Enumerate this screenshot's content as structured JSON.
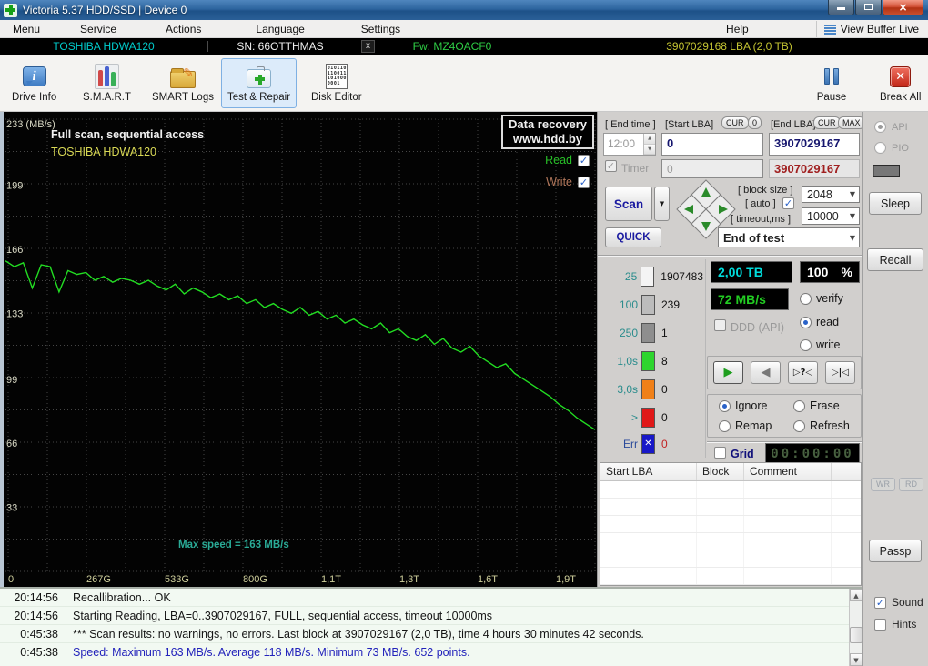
{
  "window": {
    "title": "Victoria 5.37 HDD/SSD | Device 0"
  },
  "menu": {
    "items": [
      "Menu",
      "Service",
      "Actions",
      "Language",
      "Settings"
    ],
    "help": "Help",
    "view_buffer": "View Buffer Live"
  },
  "infobar": {
    "model": "TOSHIBA HDWA120",
    "serial": "SN: 66OTTHMAS",
    "close_label": "x",
    "firmware": "Fw: MZ4OACF0",
    "capacity": "3907029168 LBA (2,0 TB)"
  },
  "toolbar": {
    "buttons": [
      "Drive Info",
      "S.M.A.R.T",
      "SMART Logs",
      "Test & Repair",
      "Disk Editor"
    ],
    "active_button": "Test & Repair",
    "pause": "Pause",
    "break_all": "Break All"
  },
  "chart_data": {
    "type": "line",
    "title": "Full scan, sequential access",
    "subtitle": "TOSHIBA HDWA120",
    "ylabel_unit": "(MB/s)",
    "ymax": 233,
    "yticks": [
      233,
      199,
      166,
      133,
      99,
      66,
      33
    ],
    "xticks": [
      "0",
      "267G",
      "533G",
      "800G",
      "1,1T",
      "1,3T",
      "1,6T",
      "1,9T"
    ],
    "grid": true,
    "legend_position": "top-right",
    "series": [
      {
        "name": "Read",
        "color": "#22dd22",
        "x_mode": "uniform fractions of full LBA span 0..3907029167",
        "speed_mbs": [
          160,
          157,
          159,
          146,
          158,
          157,
          144,
          155,
          153,
          154,
          150,
          152,
          149,
          151,
          150,
          148,
          150,
          147,
          145,
          148,
          143,
          146,
          144,
          141,
          143,
          140,
          142,
          138,
          140,
          136,
          138,
          135,
          133,
          136,
          132,
          134,
          130,
          132,
          128,
          130,
          127,
          125,
          128,
          123,
          125,
          121,
          119,
          122,
          117,
          120,
          115,
          113,
          116,
          111,
          108,
          105,
          107,
          102,
          99,
          96,
          93,
          90,
          86,
          83,
          79,
          76,
          73
        ]
      }
    ],
    "annotations": {
      "max_speed_note": "Max speed = 163 MB/s",
      "watermark": [
        "Data recovery",
        "www.hdd.by"
      ]
    },
    "stats": {
      "max_mbs": 163,
      "avg_mbs": 118,
      "min_mbs": 73,
      "points": 652
    }
  },
  "graph_overlay": {
    "read_label": "Read",
    "write_label": "Write"
  },
  "controls": {
    "end_time_label": "[ End time ]",
    "end_time": "12:00",
    "timer_label": "Timer",
    "timer_value": "0",
    "start_lba_label": "[Start LBA]",
    "cur": "CUR",
    "zero": "0",
    "start_lba": "0",
    "end_lba_label": "[End LBA]",
    "max": "MAX",
    "end_lba": "3907029167",
    "end_lba_shadow": "3907029167",
    "scan": "Scan",
    "quick": "QUICK",
    "block_size_label": "[ block size ]",
    "auto_label": "[ auto ]",
    "block_size": "2048",
    "timeout_label": "[ timeout,ms ]",
    "timeout": "10000",
    "end_action": "End of test"
  },
  "histogram": {
    "rows": [
      {
        "label": "25",
        "count": "1907483",
        "color": "#f4f4f4"
      },
      {
        "label": "100",
        "count": "239",
        "color": "#bcbcbc"
      },
      {
        "label": "250",
        "count": "1",
        "color": "#8e8e8e"
      },
      {
        "label": "1,0s",
        "count": "8",
        "color": "#2ed52e"
      },
      {
        "label": "3,0s",
        "count": "0",
        "color": "#f08018"
      },
      {
        "label": ">",
        "count": "0",
        "color": "#e01818"
      },
      {
        "label": "Err",
        "count": "0",
        "color": "#1818c8",
        "is_error": true
      }
    ]
  },
  "displays": {
    "capacity": "2,00 TB",
    "percent": "100",
    "percent_unit": "%",
    "speed": "72 MB/s"
  },
  "options": {
    "ddd": "DDD (API)",
    "verify": "verify",
    "read": "read",
    "write": "write",
    "mode_selected": "read",
    "ignore": "Ignore",
    "erase": "Erase",
    "remap": "Remap",
    "refresh": "Refresh",
    "policy_selected": "Ignore",
    "grid_label": "Grid",
    "lcd": "00:00:00"
  },
  "defect_table": {
    "headers": [
      "Start LBA",
      "Block",
      "Comment"
    ],
    "rows": []
  },
  "side": {
    "api": "API",
    "pio": "PIO",
    "sleep": "Sleep",
    "recall": "Recall",
    "wr": "WR",
    "rd": "RD",
    "passp": "Passp"
  },
  "log": {
    "rows": [
      {
        "time": "20:14:56",
        "text": "Recallibration... OK"
      },
      {
        "time": "20:14:56",
        "text": "Starting Reading, LBA=0..3907029167, FULL, sequential access, timeout 10000ms"
      },
      {
        "time": "0:45:38",
        "text": "*** Scan results: no warnings, no errors. Last block at 3907029167 (2,0 TB), time 4 hours 30 minutes 42 seconds."
      },
      {
        "time": "0:45:38",
        "text": "Speed: Maximum 163 MB/s. Average 118 MB/s. Minimum 73 MB/s. 652 points.",
        "highlight": "blue"
      }
    ],
    "sound": "Sound",
    "hints": "Hints"
  },
  "colors": {
    "speed_line_green": "#22dd22",
    "model_cyan": "#00cccc",
    "firmware_green": "#2ecc45",
    "capacity_yellow": "#c4c432",
    "log_blue": "#2323bb",
    "lcd_dim_green": "#47603f",
    "display_cyan": "#00dcdc",
    "display_green": "#22cc22"
  }
}
